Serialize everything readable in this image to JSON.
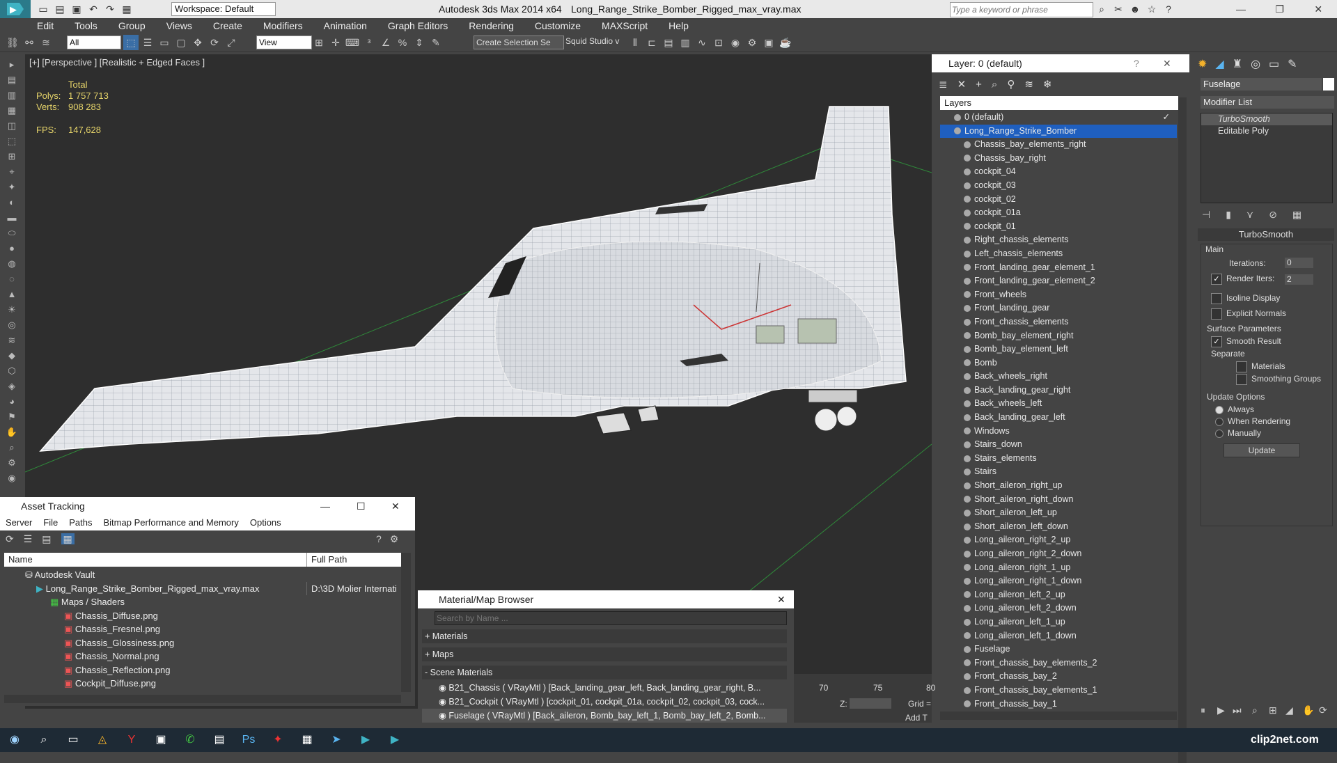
{
  "titlebar": {
    "app": "Autodesk 3ds Max  2014 x64",
    "file": "Long_Range_Strike_Bomber_Rigged_max_vray.max",
    "workspace": "Workspace: Default",
    "search_placeholder": "Type a keyword or phrase"
  },
  "menu": [
    "Edit",
    "Tools",
    "Group",
    "Views",
    "Create",
    "Modifiers",
    "Animation",
    "Graph Editors",
    "Rendering",
    "Customize",
    "MAXScript",
    "Help"
  ],
  "toolbar": {
    "filter": "All",
    "ref_coord": "View",
    "selection_set": "Create Selection Se",
    "studio": "Squid Studio v"
  },
  "viewport": {
    "label": "[+] [Perspective ] [Realistic + Edged Faces ]",
    "total_label": "Total",
    "polys_label": "Polys:",
    "polys": "1 757 713",
    "verts_label": "Verts:",
    "verts": "908 283",
    "fps_label": "FPS:",
    "fps": "147,628"
  },
  "layer_explorer": {
    "title": "Layer: 0 (default)",
    "header": "Layers",
    "default_layer": "0 (default)",
    "active_layer": "Long_Range_Strike_Bomber",
    "items": [
      "Chassis_bay_elements_right",
      "Chassis_bay_right",
      "cockpit_04",
      "cockpit_03",
      "cockpit_02",
      "cockpit_01a",
      "cockpit_01",
      "Right_chassis_elements",
      "Left_chassis_elements",
      "Front_landing_gear_element_1",
      "Front_landing_gear_element_2",
      "Front_wheels",
      "Front_landing_gear",
      "Front_chassis_elements",
      "Bomb_bay_element_right",
      "Bomb_bay_element_left",
      "Bomb",
      "Back_wheels_right",
      "Back_landing_gear_right",
      "Back_wheels_left",
      "Back_landing_gear_left",
      "Windows",
      "Stairs_down",
      "Stairs_elements",
      "Stairs",
      "Short_aileron_right_up",
      "Short_aileron_right_down",
      "Short_aileron_left_up",
      "Short_aileron_left_down",
      "Long_aileron_right_2_up",
      "Long_aileron_right_2_down",
      "Long_aileron_right_1_up",
      "Long_aileron_right_1_down",
      "Long_aileron_left_2_up",
      "Long_aileron_left_2_down",
      "Long_aileron_left_1_up",
      "Long_aileron_left_1_down",
      "Fuselage",
      "Front_chassis_bay_elements_2",
      "Front_chassis_bay_2",
      "Front_chassis_bay_elements_1",
      "Front_chassis_bay_1"
    ]
  },
  "command_panel": {
    "object_name": "Fuselage",
    "modifier_list": "Modifier List",
    "stack": [
      "TurboSmooth",
      "Editable Poly"
    ],
    "rollout_title": "TurboSmooth",
    "main_label": "Main",
    "iterations_label": "Iterations:",
    "iterations": "0",
    "render_iters_label": "Render Iters:",
    "render_iters": "2",
    "isoline": "Isoline Display",
    "explicit_normals": "Explicit Normals",
    "surface_params": "Surface Parameters",
    "smooth_result": "Smooth Result",
    "separate": "Separate",
    "materials": "Materials",
    "smoothing_groups": "Smoothing Groups",
    "update_options": "Update Options",
    "always": "Always",
    "when_rendering": "When Rendering",
    "manually": "Manually",
    "update_button": "Update"
  },
  "asset_tracking": {
    "title": "Asset Tracking",
    "menu": [
      "Server",
      "File",
      "Paths",
      "Bitmap Performance and Memory",
      "Options"
    ],
    "col_name": "Name",
    "col_path": "Full Path",
    "vault": "Autodesk Vault",
    "file": "Long_Range_Strike_Bomber_Rigged_max_vray.max",
    "file_path": "D:\\3D Molier Internati",
    "maps_folder": "Maps / Shaders",
    "maps": [
      "Chassis_Diffuse.png",
      "Chassis_Fresnel.png",
      "Chassis_Glossiness.png",
      "Chassis_Normal.png",
      "Chassis_Reflection.png",
      "Cockpit_Diffuse.png"
    ]
  },
  "material_browser": {
    "title": "Material/Map Browser",
    "search_placeholder": "Search by Name ...",
    "groups": [
      "+ Materials",
      "+ Maps",
      "- Scene Materials"
    ],
    "materials": [
      "B21_Chassis ( VRayMtl ) [Back_landing_gear_left, Back_landing_gear_right, B...",
      "B21_Cockpit ( VRayMtl ) [cockpit_01, cockpit_01a, cockpit_02, cockpit_03, cock...",
      "Fuselage ( VRayMtl ) [Back_aileron, Bomb_bay_left_1, Bomb_bay_left_2, Bomb..."
    ]
  },
  "timeline": {
    "ticks": [
      "70",
      "75",
      "80"
    ],
    "z_label": "Z:",
    "grid_label": "Grid =",
    "add_t": "Add T"
  },
  "watermark": "clip2net.com"
}
